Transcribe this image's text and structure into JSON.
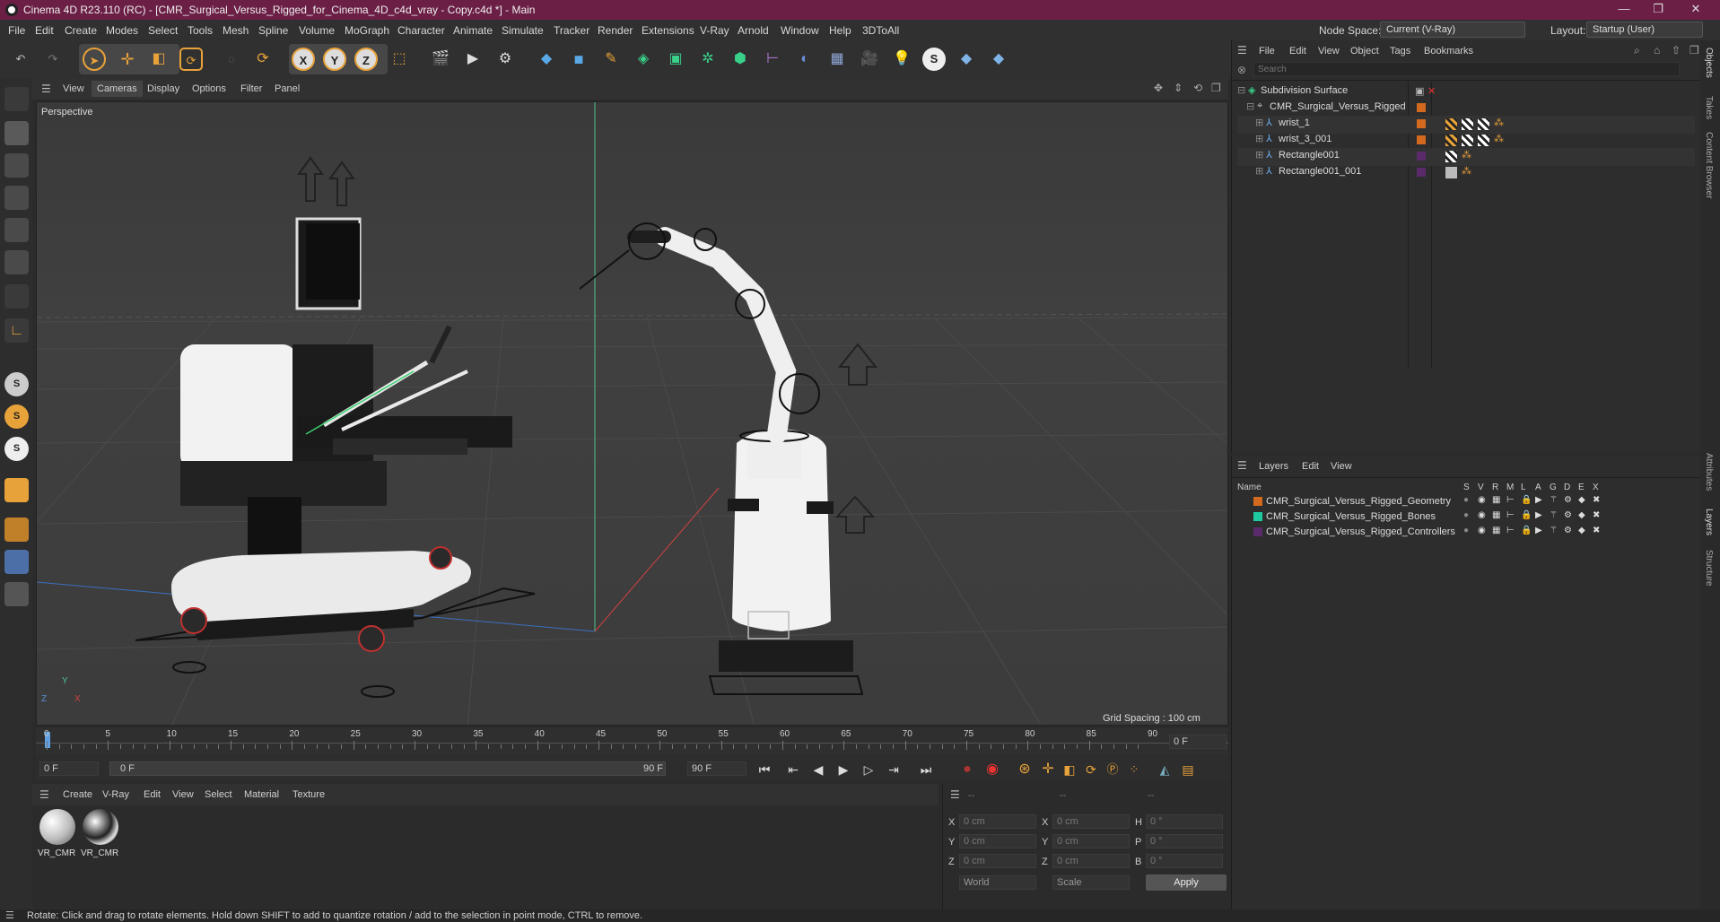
{
  "window": {
    "title": "Cinema 4D R23.110 (RC) - [CMR_Surgical_Versus_Rigged_for_Cinema_4D_c4d_vray - Copy.c4d *] - Main",
    "minimize": "—",
    "maximize": "❐",
    "close": "✕"
  },
  "menubar": {
    "items": [
      "File",
      "Edit",
      "Create",
      "Modes",
      "Select",
      "Tools",
      "Mesh",
      "Spline",
      "Volume",
      "MoGraph",
      "Character",
      "Animate",
      "Simulate",
      "Tracker",
      "Render",
      "Extensions",
      "V-Ray",
      "Arnold",
      "Window",
      "Help",
      "3DToAll"
    ],
    "node_space_label": "Node Space:",
    "node_space_value": "Current (V-Ray)",
    "layout_label": "Layout:",
    "layout_value": "Startup (User)"
  },
  "viewport": {
    "menu": [
      "View",
      "Cameras",
      "Display",
      "Options",
      "Filter",
      "Panel"
    ],
    "active_menu": "Cameras",
    "camera_label": "Perspective",
    "grid_spacing": "Grid Spacing : 100 cm",
    "axis_y": "Y",
    "axis_z": "Z",
    "axis_x": "X"
  },
  "timeline": {
    "ticks": [
      "0",
      "5",
      "10",
      "15",
      "20",
      "25",
      "30",
      "35",
      "40",
      "45",
      "50",
      "55",
      "60",
      "65",
      "70",
      "75",
      "80",
      "85",
      "90"
    ],
    "current_frame": "0 F",
    "start_frame": "0 F",
    "range_start": "0 F",
    "range_end": "90 F",
    "end_frame": "90 F"
  },
  "materials": {
    "menu": [
      "Create",
      "V-Ray",
      "Edit",
      "View",
      "Select",
      "Material",
      "Texture"
    ],
    "items": [
      {
        "label": "VR_CMR"
      },
      {
        "label": "VR_CMR"
      }
    ]
  },
  "coordinates": {
    "header": [
      "--",
      "--",
      "--"
    ],
    "rows": [
      {
        "a": "X",
        "av": "0 cm",
        "b": "X",
        "bv": "0 cm",
        "c": "H",
        "cv": "0 °"
      },
      {
        "a": "Y",
        "av": "0 cm",
        "b": "Y",
        "bv": "0 cm",
        "c": "P",
        "cv": "0 °"
      },
      {
        "a": "Z",
        "av": "0 cm",
        "b": "Z",
        "bv": "0 cm",
        "c": "B",
        "cv": "0 °"
      }
    ],
    "mode": "World",
    "scale": "Scale",
    "apply": "Apply"
  },
  "objects": {
    "menu": [
      "File",
      "Edit",
      "View",
      "Object",
      "Tags",
      "Bookmarks"
    ],
    "search_placeholder": "Search",
    "tree": [
      {
        "name": "Subdivision Surface"
      },
      {
        "name": "CMR_Surgical_Versus_Rigged"
      },
      {
        "name": "wrist_1"
      },
      {
        "name": "wrist_3_001"
      },
      {
        "name": "Rectangle001"
      },
      {
        "name": "Rectangle001_001"
      }
    ]
  },
  "layers": {
    "menu": [
      "Layers",
      "Edit",
      "View"
    ],
    "col_name": "Name",
    "col_flags": [
      "S",
      "V",
      "R",
      "M",
      "L",
      "A",
      "G",
      "D",
      "E",
      "X"
    ],
    "items": [
      {
        "name": "CMR_Surgical_Versus_Rigged_Geometry",
        "color": "#d2691e"
      },
      {
        "name": "CMR_Surgical_Versus_Rigged_Bones",
        "color": "#1fc9a0"
      },
      {
        "name": "CMR_Surgical_Versus_Rigged_Controllers",
        "color": "#5a2a6a"
      }
    ]
  },
  "sidetabs": [
    "Objects",
    "Takes",
    "Content Browser",
    "Attributes",
    "Layers",
    "Structure"
  ],
  "status": "Rotate: Click and drag to rotate elements. Hold down SHIFT to add to quantize rotation / add to the selection in point mode, CTRL to remove."
}
